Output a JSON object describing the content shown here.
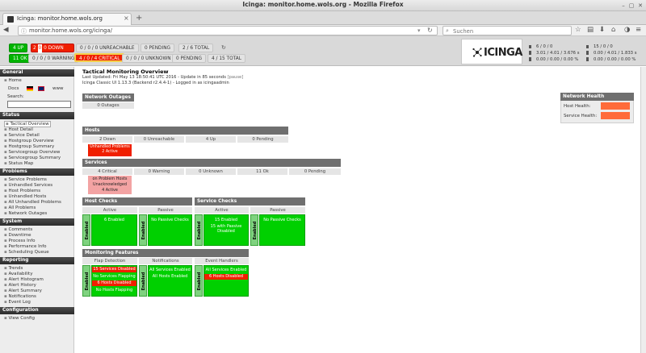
{
  "window": {
    "title": "Icinga: monitor.home.wols.org - Mozilla Firefox",
    "min": "–",
    "max": "▢",
    "close": "✕"
  },
  "tab": {
    "label": "Icinga: monitor.home.wols.org",
    "close": "×",
    "new": "+"
  },
  "nav": {
    "url": "monitor.home.wols.org/icinga/",
    "search_placeholder": "Suchen"
  },
  "header": {
    "host_row": [
      "4 UP",
      "2",
      "0",
      "0 DOWN",
      "0 / 0 / 0 UNREACHABLE",
      "0 PENDING",
      "2 / 6 TOTAL"
    ],
    "service_row": [
      "11 OK",
      "0 / 0 / 0 WARNING",
      "4 / 0 / 4 CRITICAL",
      "0 / 0 / 0 UNKNOWN",
      "0 PENDING",
      "4 / 15 TOTAL"
    ],
    "logo_text": "ICINGA",
    "stats": {
      "a1": "6 / 0 / 0",
      "a2": "3.01 / 4.01 / 3.676 s",
      "a3": "0.00 / 0.00 / 0.00 %",
      "b1": "15 / 0 / 0",
      "b2": "0.00 / 4.01 / 1.833 s",
      "b3": "0.00 / 0.00 / 0.00 %"
    }
  },
  "sidebar": {
    "general": "General",
    "home": "Home",
    "docs": "Docs",
    "www": "www",
    "search": "Search:",
    "status": "Status",
    "status_items": [
      "Tactical Overview",
      "Host Detail",
      "Service Detail",
      "Hostgroup Overview",
      "Hostgroup Summary",
      "Servicegroup Overview",
      "Servicegroup Summary",
      "Status Map"
    ],
    "problems": "Problems",
    "problems_items": [
      "Service Problems",
      "Unhandled Services",
      "Host Problems",
      "Unhandled Hosts",
      "All Unhandled Problems",
      "All Problems",
      "Network Outages"
    ],
    "system": "System",
    "system_items": [
      "Comments",
      "Downtime",
      "Process Info",
      "Performance Info",
      "Scheduling Queue"
    ],
    "reporting": "Reporting",
    "reporting_items": [
      "Trends",
      "Availability",
      "Alert Histogram",
      "Alert History",
      "Alert Summary",
      "Notifications",
      "Event Log"
    ],
    "configuration": "Configuration",
    "configuration_items": [
      "View Config"
    ]
  },
  "main": {
    "title": "Tactical Monitoring Overview",
    "updated": "Last Updated: Fri May 13 18:50:41 UTC 2016 - Update in 85 seconds",
    "pause": "[pause]",
    "classic": "Icinga Classic UI 1.13.3 (Backend r2.4.4-1) - Logged in as icingaadmin",
    "outages_head": "Network Outages",
    "outages_val": "0 Outages",
    "hosts_head": "Hosts",
    "hosts_cells": [
      "2 Down",
      "0 Unreachable",
      "4 Up",
      "0 Pending"
    ],
    "hosts_unhandled": [
      "Unhandled Problems",
      "2 Active"
    ],
    "services_head": "Services",
    "services_cells": [
      "4 Critical",
      "0 Warning",
      "0 Unknown",
      "11 Ok",
      "0 Pending"
    ],
    "services_problem": [
      "on Problem Hosts",
      "Unacknowledged",
      "4 Active"
    ],
    "host_checks_head": "Host Checks",
    "service_checks_head": "Service Checks",
    "active": "Active",
    "passive": "Passive",
    "enabled": "Enabled",
    "hc_active": "6 Enabled",
    "hc_passive": "No Passive Checks",
    "sc_active": [
      "15 Enabled",
      "15 with Passive",
      "Disabled"
    ],
    "sc_passive": "No Passive Checks",
    "features_head": "Monitoring Features",
    "flap_head": "Flap Detection",
    "notif_head": "Notifications",
    "event_head": "Event Handlers",
    "flap": [
      "15 Services Disabled",
      "No Services Flapping",
      "6 Hosts Disabled",
      "No Hosts Flapping"
    ],
    "notif": [
      "All Services Enabled",
      "All Hosts Enabled"
    ],
    "event": [
      "All Services Enabled",
      "6 Hosts Disabled"
    ]
  },
  "network_health": {
    "head": "Network Health",
    "host": "Host Health:",
    "service": "Service Health:"
  }
}
